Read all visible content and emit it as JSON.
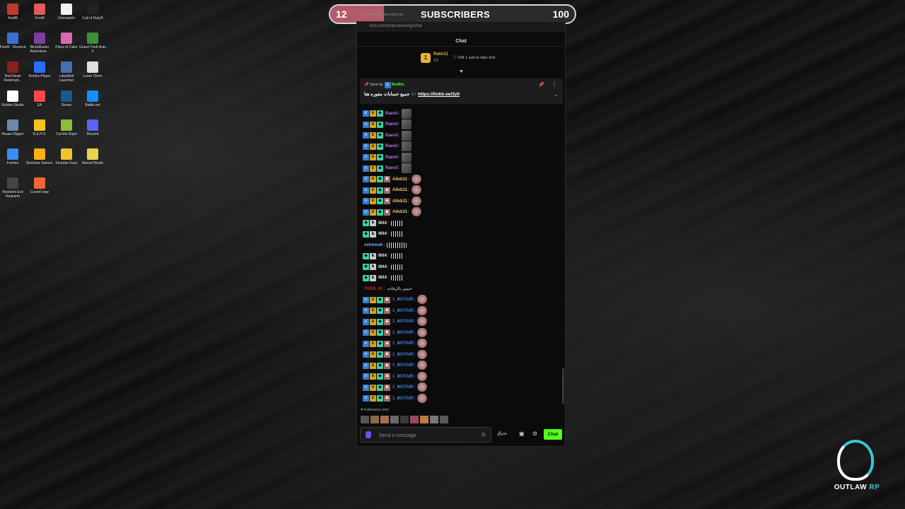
{
  "desktop": {
    "icons": [
      {
        "label": "RedM",
        "color": "#c0392b"
      },
      {
        "label": "FiveM",
        "color": "#e2585b"
      },
      {
        "label": "Overwatch",
        "color": "#f0f0f0"
      },
      {
        "label": "Call of Duty®",
        "color": "#222222"
      },
      {
        "label": "FiveM - Shortcut",
        "color": "#3b6fd6"
      },
      {
        "label": "BlockBuster Adventure...",
        "color": "#7a3fa0"
      },
      {
        "label": "Piece of Cake",
        "color": "#d66bb0"
      },
      {
        "label": "Grand Theft Auto V",
        "color": "#3d8f3a"
      },
      {
        "label": "Red Dead Redempti...",
        "color": "#8a1f1f"
      },
      {
        "label": "Roblox Player",
        "color": "#2b6cff"
      },
      {
        "label": "LabyMod Launcher",
        "color": "#4a6fb0"
      },
      {
        "label": "Lunar Client",
        "color": "#dddddd"
      },
      {
        "label": "Roblox Studio",
        "color": "#ffffff"
      },
      {
        "label": "EA",
        "color": "#ff4747"
      },
      {
        "label": "Steam",
        "color": "#1b5a8a"
      },
      {
        "label": "Battle.net",
        "color": "#148eff"
      },
      {
        "label": "House Flipper",
        "color": "#6b8aa8"
      },
      {
        "label": "R.E.P.O.",
        "color": "#f0c419"
      },
      {
        "label": "Cut the Rope",
        "color": "#8bbd3c"
      },
      {
        "label": "Discord",
        "color": "#5865f2"
      },
      {
        "label": "Fortnite",
        "color": "#3b8ef0"
      },
      {
        "label": "Rockstar Games ...",
        "color": "#fcaf17"
      },
      {
        "label": "Stumble Guys",
        "color": "#f2c230"
      },
      {
        "label": "Marvel Rivals",
        "color": "#e8d44d"
      },
      {
        "label": "Resident Evil Requiem",
        "color": "#444444"
      },
      {
        "label": "CurseForge",
        "color": "#f16436"
      }
    ]
  },
  "subscribers": {
    "current": "12",
    "title": "SUBSCRIBERS",
    "goal": "100",
    "progress_fraction": 0.12,
    "url": "kick.com/popout/evelyj/chat",
    "fill_color": "#b35a6a"
  },
  "chat": {
    "url": "kick.com/popout/evelyj/chat",
    "header": "Chat",
    "leader": {
      "badge": "1",
      "name": "Relin11",
      "amount": "10",
      "gift_text": "Gift 1 sub to take 2nd"
    },
    "pinned": {
      "sent_by": "Sent by",
      "bot_name": "BotRix",
      "message_arabic": "جميع حسابات مفوره هنا 🎶",
      "link": "https://linktr.ee/3y0"
    },
    "messages": [
      {
        "user": "Raevii",
        "color": "#b86cf0",
        "badges": [
          "x",
          "c",
          "s"
        ],
        "emote": "grey"
      },
      {
        "user": "Raevii",
        "color": "#b86cf0",
        "badges": [
          "x",
          "c",
          "s"
        ],
        "emote": "grey"
      },
      {
        "user": "Raevii",
        "color": "#b86cf0",
        "badges": [
          "x",
          "c",
          "s"
        ],
        "emote": "grey"
      },
      {
        "user": "Raevii",
        "color": "#b86cf0",
        "badges": [
          "x",
          "c",
          "s"
        ],
        "emote": "grey"
      },
      {
        "user": "Raevii",
        "color": "#b86cf0",
        "badges": [
          "x",
          "c",
          "s"
        ],
        "emote": "grey"
      },
      {
        "user": "Raevii",
        "color": "#b86cf0",
        "badges": [
          "x",
          "c",
          "s"
        ],
        "emote": "grey"
      },
      {
        "user": "Alixb11",
        "color": "#f2d36b",
        "badges": [
          "x",
          "c",
          "s",
          "g"
        ],
        "emote": "pink"
      },
      {
        "user": "Alixb11",
        "color": "#f2d36b",
        "badges": [
          "x",
          "c",
          "s",
          "g"
        ],
        "emote": "pink"
      },
      {
        "user": "Alixb11",
        "color": "#f2d36b",
        "badges": [
          "x",
          "c",
          "s",
          "g"
        ],
        "emote": "pink"
      },
      {
        "user": "Alixb11",
        "color": "#f2d36b",
        "badges": [
          "x",
          "c",
          "s",
          "g"
        ],
        "emote": "pink"
      },
      {
        "user": "l6lt4",
        "color": "#e8e8e8",
        "badges": [
          "s",
          "r"
        ],
        "emote": "bars"
      },
      {
        "user": "l6lt4",
        "color": "#e8e8e8",
        "badges": [
          "s",
          "r"
        ],
        "emote": "bars"
      },
      {
        "user": "vshmook",
        "color": "#7aa8ff",
        "badges": [],
        "emote": "bars2"
      },
      {
        "user": "l6lt4",
        "color": "#e8e8e8",
        "badges": [
          "s",
          "r"
        ],
        "emote": "bars"
      },
      {
        "user": "l6lt4",
        "color": "#e8e8e8",
        "badges": [
          "s",
          "r"
        ],
        "emote": "bars"
      },
      {
        "user": "l6lt4",
        "color": "#e8e8e8",
        "badges": [
          "s",
          "r"
        ],
        "emote": "bars"
      },
      {
        "user": "7OSN_01",
        "color": "#e02020",
        "badges": [],
        "emote": "none",
        "text": "حبيبي بالرقاده"
      },
      {
        "user": "1_MUTAIR",
        "color": "#3b7ff0",
        "badges": [
          "x",
          "c",
          "s",
          "g"
        ],
        "emote": "pink"
      },
      {
        "user": "1_MUTAIR",
        "color": "#3b7ff0",
        "badges": [
          "x",
          "c",
          "s",
          "g"
        ],
        "emote": "pink"
      },
      {
        "user": "1_MUTAIR",
        "color": "#3b7ff0",
        "badges": [
          "x",
          "c",
          "s",
          "g"
        ],
        "emote": "pink"
      },
      {
        "user": "1_MUTAIR",
        "color": "#3b7ff0",
        "badges": [
          "x",
          "c",
          "s",
          "g"
        ],
        "emote": "pink"
      },
      {
        "user": "1_MUTAIR",
        "color": "#3b7ff0",
        "badges": [
          "x",
          "c",
          "s",
          "g"
        ],
        "emote": "pink"
      },
      {
        "user": "1_MUTAIR",
        "color": "#3b7ff0",
        "badges": [
          "x",
          "c",
          "s",
          "g"
        ],
        "emote": "pink"
      },
      {
        "user": "1_MUTAIR",
        "color": "#3b7ff0",
        "badges": [
          "x",
          "c",
          "s",
          "g"
        ],
        "emote": "pink"
      },
      {
        "user": "1_MUTAIR",
        "color": "#3b7ff0",
        "badges": [
          "x",
          "c",
          "s",
          "g"
        ],
        "emote": "pink"
      },
      {
        "user": "1_MUTAIR",
        "color": "#3b7ff0",
        "badges": [
          "x",
          "c",
          "s",
          "g"
        ],
        "emote": "pink"
      },
      {
        "user": "1_MUTAIR",
        "color": "#3b7ff0",
        "badges": [
          "x",
          "c",
          "s",
          "g"
        ],
        "emote": "pink"
      }
    ],
    "followers_only": "Followers only",
    "input_placeholder": "Send a message",
    "send_label": "Chat",
    "accent_color": "#53fc18"
  },
  "logo": {
    "brand": "OUTLAW",
    "suffix": "RP"
  }
}
